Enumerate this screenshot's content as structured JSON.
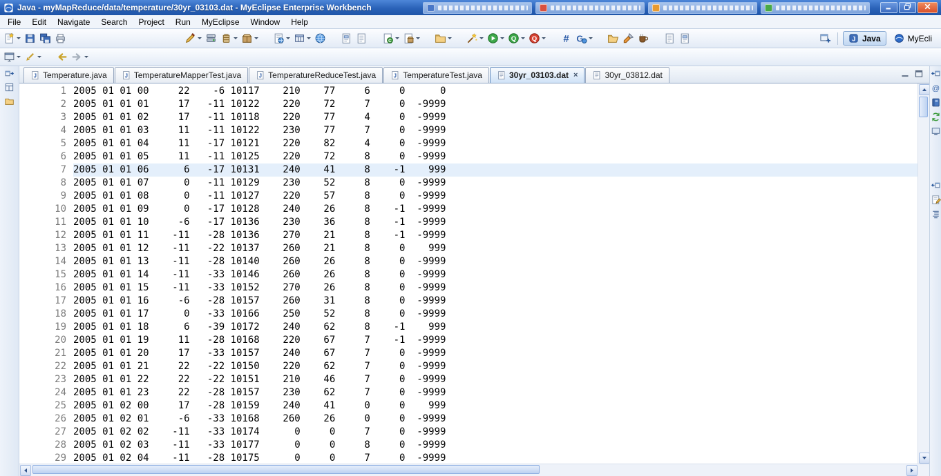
{
  "window": {
    "title": "Java - myMapReduce/data/temperature/30yr_03103.dat - MyEclipse Enterprise Workbench",
    "app_icon": "app-logo",
    "controls": [
      {
        "name": "minimize",
        "icon": "win-min"
      },
      {
        "name": "restore",
        "icon": "win-max"
      },
      {
        "name": "close",
        "icon": "win-close"
      }
    ],
    "taskbar_pills": [
      {
        "icon_color": "#4a78c8"
      },
      {
        "icon_color": "#d85040"
      },
      {
        "icon_color": "#e89a30"
      },
      {
        "icon_color": "#48a848"
      }
    ]
  },
  "menu_bar": {
    "items": [
      "File",
      "Edit",
      "Navigate",
      "Search",
      "Project",
      "Run",
      "MyEclipse",
      "Window",
      "Help"
    ]
  },
  "toolbars": {
    "row1": [
      {
        "items": [
          {
            "icon": "new-doc",
            "caret": true
          },
          {
            "icon": "save"
          },
          {
            "icon": "save-all"
          },
          {
            "icon": "print"
          }
        ]
      },
      {
        "spacer": 150
      },
      {
        "items": [
          {
            "icon": "deploy",
            "caret": true
          },
          {
            "icon": "server"
          },
          {
            "icon": "jar",
            "caret": true
          },
          {
            "icon": "package",
            "caret": true
          }
        ]
      },
      {
        "items": [
          {
            "icon": "webdoc",
            "caret": true
          },
          {
            "icon": "table",
            "caret": true
          },
          {
            "icon": "globe"
          }
        ]
      },
      {
        "items": [
          {
            "icon": "doc2"
          },
          {
            "icon": "doc1"
          }
        ]
      },
      {
        "items": [
          {
            "icon": "wiz-class",
            "caret": true
          },
          {
            "icon": "wiz-pkg",
            "caret": true
          }
        ]
      },
      {
        "items": [
          {
            "icon": "tomcat",
            "caret": true
          }
        ]
      },
      {
        "items": [
          {
            "icon": "wand",
            "caret": true
          },
          {
            "icon": "run",
            "caret": true
          },
          {
            "icon": "run-server",
            "caret": true
          },
          {
            "icon": "stop-server",
            "caret": true
          }
        ]
      },
      {
        "items": [
          {
            "icon": "grid"
          },
          {
            "icon": "gweb",
            "caret": true
          }
        ]
      },
      {
        "items": [
          {
            "icon": "folder-open"
          },
          {
            "icon": "brush"
          },
          {
            "icon": "coffee"
          }
        ]
      },
      {
        "items": [
          {
            "icon": "doc1"
          },
          {
            "icon": "doc2"
          }
        ]
      }
    ],
    "row2": [
      {
        "items": [
          {
            "icon": "console-run",
            "caret": true
          },
          {
            "icon": "mark",
            "caret": true
          }
        ]
      },
      {
        "items": [
          {
            "icon": "back"
          },
          {
            "icon": "fwd",
            "caret": true
          }
        ]
      }
    ]
  },
  "perspectives": {
    "open_icon": "persp-open",
    "items": [
      {
        "label": "Java",
        "icon": "java-persp",
        "active": true
      },
      {
        "label": "MyEcli",
        "icon": "myeclipse-persp",
        "active": false
      }
    ]
  },
  "editor_tabs": {
    "tabs": [
      {
        "label": "Temperature.java",
        "kind": "java"
      },
      {
        "label": "TemperatureMapperTest.java",
        "kind": "java"
      },
      {
        "label": "TemperatureReduceTest.java",
        "kind": "java"
      },
      {
        "label": "TemperatureTest.java",
        "kind": "java"
      },
      {
        "label": "30yr_03103.dat",
        "kind": "dat",
        "active": true,
        "close_visible": true
      },
      {
        "label": "30yr_03812.dat",
        "kind": "dat"
      }
    ],
    "actions": [
      {
        "name": "minimize-view",
        "icon": "min-view"
      },
      {
        "name": "maximize-view",
        "icon": "max-view"
      }
    ]
  },
  "left_strip": [
    {
      "icon": "restore-l"
    },
    {
      "icon": "layout"
    },
    {
      "icon": "folder"
    }
  ],
  "right_strip_top": [
    {
      "icon": "restore-r"
    },
    {
      "icon": "at"
    },
    {
      "icon": "book"
    },
    {
      "icon": "sync"
    },
    {
      "icon": "monitor"
    }
  ],
  "right_strip_bottom": [
    {
      "icon": "restore-r"
    },
    {
      "icon": "snippet"
    },
    {
      "icon": "outline"
    }
  ],
  "editor": {
    "file": "30yr_03103.dat",
    "current_line": 7,
    "rows": [
      [
        "2005 01 01 00",
        22,
        -6,
        10117,
        210,
        77,
        6,
        0,
        0
      ],
      [
        "2005 01 01 01",
        17,
        -11,
        10122,
        220,
        72,
        7,
        0,
        -9999
      ],
      [
        "2005 01 01 02",
        17,
        -11,
        10118,
        220,
        77,
        4,
        0,
        -9999
      ],
      [
        "2005 01 01 03",
        11,
        -11,
        10122,
        230,
        77,
        7,
        0,
        -9999
      ],
      [
        "2005 01 01 04",
        11,
        -17,
        10121,
        220,
        82,
        4,
        0,
        -9999
      ],
      [
        "2005 01 01 05",
        11,
        -11,
        10125,
        220,
        72,
        8,
        0,
        -9999
      ],
      [
        "2005 01 01 06",
        6,
        -17,
        10131,
        240,
        41,
        8,
        -1,
        999
      ],
      [
        "2005 01 01 07",
        0,
        -11,
        10129,
        230,
        52,
        8,
        0,
        -9999
      ],
      [
        "2005 01 01 08",
        0,
        -11,
        10127,
        220,
        57,
        8,
        0,
        -9999
      ],
      [
        "2005 01 01 09",
        0,
        -17,
        10128,
        240,
        26,
        8,
        -1,
        -9999
      ],
      [
        "2005 01 01 10",
        -6,
        -17,
        10136,
        230,
        36,
        8,
        -1,
        -9999
      ],
      [
        "2005 01 01 11",
        -11,
        -28,
        10136,
        270,
        21,
        8,
        -1,
        -9999
      ],
      [
        "2005 01 01 12",
        -11,
        -22,
        10137,
        260,
        21,
        8,
        0,
        999
      ],
      [
        "2005 01 01 13",
        -11,
        -28,
        10140,
        260,
        26,
        8,
        0,
        -9999
      ],
      [
        "2005 01 01 14",
        -11,
        -33,
        10146,
        260,
        26,
        8,
        0,
        -9999
      ],
      [
        "2005 01 01 15",
        -11,
        -33,
        10152,
        270,
        26,
        8,
        0,
        -9999
      ],
      [
        "2005 01 01 16",
        -6,
        -28,
        10157,
        260,
        31,
        8,
        0,
        -9999
      ],
      [
        "2005 01 01 17",
        0,
        -33,
        10166,
        250,
        52,
        8,
        0,
        -9999
      ],
      [
        "2005 01 01 18",
        6,
        -39,
        10172,
        240,
        62,
        8,
        -1,
        999
      ],
      [
        "2005 01 01 19",
        11,
        -28,
        10168,
        220,
        67,
        7,
        -1,
        -9999
      ],
      [
        "2005 01 01 20",
        17,
        -33,
        10157,
        240,
        67,
        7,
        0,
        -9999
      ],
      [
        "2005 01 01 21",
        22,
        -22,
        10150,
        220,
        62,
        7,
        0,
        -9999
      ],
      [
        "2005 01 01 22",
        22,
        -22,
        10151,
        210,
        46,
        7,
        0,
        -9999
      ],
      [
        "2005 01 01 23",
        22,
        -28,
        10157,
        230,
        62,
        7,
        0,
        -9999
      ],
      [
        "2005 01 02 00",
        17,
        -28,
        10159,
        240,
        41,
        0,
        0,
        999
      ],
      [
        "2005 01 02 01",
        -6,
        -33,
        10168,
        260,
        26,
        0,
        0,
        -9999
      ],
      [
        "2005 01 02 02",
        -11,
        -33,
        10174,
        0,
        0,
        7,
        0,
        -9999
      ],
      [
        "2005 01 02 03",
        -11,
        -33,
        10177,
        0,
        0,
        8,
        0,
        -9999
      ],
      [
        "2005 01 02 04",
        -11,
        -28,
        10175,
        0,
        0,
        7,
        0,
        -9999
      ]
    ]
  },
  "colors": {
    "titlebar": "#2a62b8",
    "close_button": "#d8502a",
    "current_line_highlight": "#e4effb",
    "line_number": "#7c7c7c",
    "toolbar_bg": "#e3ebf6"
  }
}
